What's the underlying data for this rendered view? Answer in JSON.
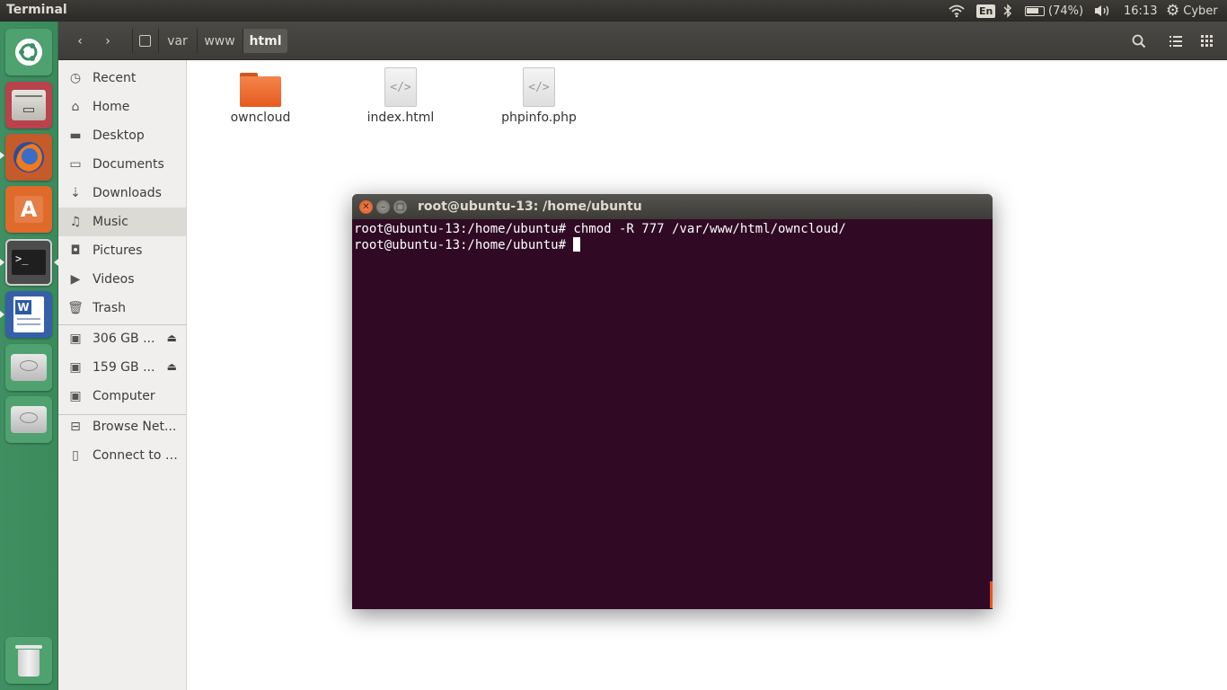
{
  "top_panel": {
    "app_title": "Terminal",
    "language": "En",
    "battery": "(74%)",
    "time": "16:13",
    "user": "Cyber"
  },
  "launcher": {
    "items": [
      "Ubuntu Dash",
      "Files",
      "Firefox",
      "Ubuntu Software Center",
      "Terminal",
      "LibreOffice Writer",
      "Disk",
      "Disk",
      "Trash"
    ]
  },
  "file_manager": {
    "breadcrumbs": [
      "var",
      "www",
      "html"
    ],
    "sidebar": {
      "items": [
        {
          "label": "Recent",
          "icon": "clock-icon"
        },
        {
          "label": "Home",
          "icon": "home-icon"
        },
        {
          "label": "Desktop",
          "icon": "folder-icon"
        },
        {
          "label": "Documents",
          "icon": "documents-icon"
        },
        {
          "label": "Downloads",
          "icon": "download-icon"
        },
        {
          "label": "Music",
          "icon": "music-icon"
        },
        {
          "label": "Pictures",
          "icon": "camera-icon"
        },
        {
          "label": "Videos",
          "icon": "video-icon"
        },
        {
          "label": "Trash",
          "icon": "trash-icon"
        }
      ],
      "devices": [
        {
          "label": "306 GB ...",
          "icon": "drive-icon"
        },
        {
          "label": "159 GB ...",
          "icon": "drive-icon"
        },
        {
          "label": "Computer",
          "icon": "drive-icon"
        }
      ],
      "network": [
        {
          "label": "Browse Net...",
          "icon": "network-icon"
        },
        {
          "label": "Connect to S...",
          "icon": "server-icon"
        }
      ]
    },
    "files": [
      {
        "name": "owncloud",
        "type": "folder"
      },
      {
        "name": "index.html",
        "type": "html"
      },
      {
        "name": "phpinfo.php",
        "type": "php"
      }
    ]
  },
  "terminal": {
    "title": "root@ubuntu-13: /home/ubuntu",
    "lines": [
      "root@ubuntu-13:/home/ubuntu# chmod -R 777 /var/www/html/owncloud/",
      "root@ubuntu-13:/home/ubuntu# "
    ]
  },
  "colors": {
    "terminal_bg": "#300a24",
    "launcher_bg": "#3f8f62",
    "accent": "#e95420"
  }
}
